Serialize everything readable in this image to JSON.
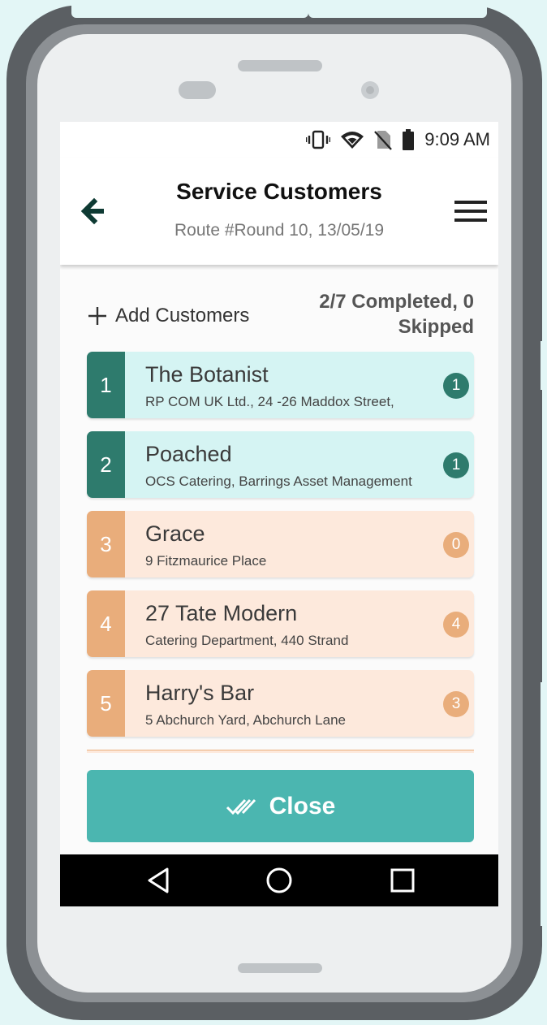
{
  "status_bar": {
    "time": "9:09 AM",
    "icons": [
      "vibrate-icon",
      "wifi-icon",
      "no-sim-icon",
      "battery-icon"
    ]
  },
  "header": {
    "title": "Service Customers",
    "subtitle": "Route #Round 10, 13/05/19",
    "back_icon": "arrow-left-icon",
    "menu_icon": "hamburger-menu-icon"
  },
  "toolbar": {
    "add_label": "Add Customers",
    "progress_line1": "2/7 Completed, 0",
    "progress_line2": "Skipped"
  },
  "customers": [
    {
      "number": "1",
      "name": "The Botanist",
      "address": "RP COM UK Ltd., 24 -26 Maddox Street,",
      "count": "1",
      "status": "done"
    },
    {
      "number": "2",
      "name": "Poached",
      "address": "OCS Catering, Barrings Asset Management",
      "count": "1",
      "status": "done"
    },
    {
      "number": "3",
      "name": "Grace",
      "address": "9 Fitzmaurice Place",
      "count": "0",
      "status": "pending"
    },
    {
      "number": "4",
      "name": "27 Tate Modern",
      "address": "Catering Department, 440 Strand",
      "count": "4",
      "status": "pending"
    },
    {
      "number": "5",
      "name": "Harry's Bar",
      "address": "5 Abchurch Yard, Abchurch Lane",
      "count": "3",
      "status": "pending"
    }
  ],
  "close_button": {
    "label": "Close",
    "icon": "double-check-icon"
  },
  "colors": {
    "completed": "#2e7b6d",
    "completed_bg": "#d5f4f3",
    "pending": "#e9ad7b",
    "pending_bg": "#fde9dc",
    "primary": "#4bb6b0"
  }
}
